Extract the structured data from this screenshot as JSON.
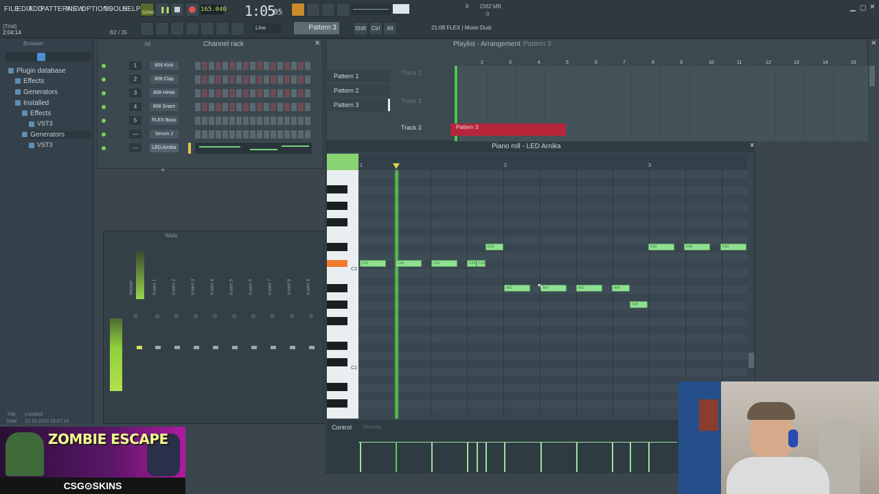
{
  "menu": [
    "FILE",
    "EDIT",
    "ADD",
    "PATTERNS",
    "VIEW",
    "OPTIONS",
    "TOOLS",
    "HELP"
  ],
  "transport": {
    "song_label": "SONG",
    "tempo": "165.040",
    "time": "1:05",
    "time_sub": "05",
    "cpu": "8",
    "memory": "1582 MB",
    "voices": "0"
  },
  "status": {
    "trial": "(Trial)",
    "position": "2:04:14",
    "bar": "B2 / 35"
  },
  "toolbar": {
    "snap_mode": "Line",
    "pattern": "Pattern 3",
    "shift": "Shift",
    "ctrl": "Ctrl",
    "alt": "Alt",
    "hint": "21:08 FLEX | Moon Dust"
  },
  "browser": {
    "title": "Browser",
    "filter": "All",
    "items": [
      {
        "label": "Plugin database",
        "indent": 0
      },
      {
        "label": "Effects",
        "indent": 1
      },
      {
        "label": "Generators",
        "indent": 1
      },
      {
        "label": "Installed",
        "indent": 1
      },
      {
        "label": "Effects",
        "indent": 2
      },
      {
        "label": "VST3",
        "indent": 3
      },
      {
        "label": "Generators",
        "indent": 2
      },
      {
        "label": "VST3",
        "indent": 3
      }
    ],
    "footer_title_label": "Title",
    "footer_title_value": "Installed",
    "footer_date_label": "Date",
    "footer_date_value": "23.10.2023 16:07:18"
  },
  "channel_rack": {
    "title": "Channel rack",
    "filter": "All",
    "channels": [
      {
        "num": "1",
        "name": "808 Kick"
      },
      {
        "num": "2",
        "name": "808 Clap"
      },
      {
        "num": "3",
        "name": "808 HiHat"
      },
      {
        "num": "4",
        "name": "808 Snare"
      },
      {
        "num": "5",
        "name": "FLEX Bass"
      },
      {
        "num": "—",
        "name": "Serum 2"
      },
      {
        "num": "—",
        "name": "LED Arnika"
      }
    ]
  },
  "mixer": {
    "title": "Wide",
    "strips": [
      "Master",
      "Insert 1",
      "Insert 2",
      "Insert 3",
      "Insert 4",
      "Insert 5",
      "Insert 6",
      "Insert 7",
      "Insert 8",
      "Insert 9"
    ]
  },
  "playlist": {
    "title": "Playlist - Arrangement",
    "pattern": "Pattern 3",
    "patterns": [
      "Pattern 1",
      "Pattern 2",
      "Pattern 3"
    ],
    "tracks": [
      "Track 1",
      "Track 2",
      "Track 3"
    ],
    "ruler": [
      "2",
      "3",
      "4",
      "5",
      "6",
      "7",
      "8",
      "9",
      "10",
      "11",
      "12",
      "13",
      "14",
      "15"
    ],
    "clip_label": "Pattern 3"
  },
  "piano_roll": {
    "title": "Piano roll - LED Arnika",
    "ruler": [
      "1",
      "2",
      "3"
    ],
    "octave_labels": [
      "C3",
      "C2"
    ],
    "control_label": "Control",
    "control_param": "Velocity",
    "notes": [
      {
        "label": "C#3",
        "row": 2
      },
      {
        "label": "C#3",
        "row": 2
      },
      {
        "label": "C#3",
        "row": 2
      },
      {
        "label": "C#3",
        "row": 2
      },
      {
        "label": "C#3",
        "row": 2
      },
      {
        "label": "D#3",
        "row": 0
      },
      {
        "label": "A#2",
        "row": 5
      },
      {
        "label": "A#2",
        "row": 5
      },
      {
        "label": "A#2",
        "row": 5
      },
      {
        "label": "A#2",
        "row": 5
      },
      {
        "label": "G#2",
        "row": 7
      },
      {
        "label": "D#3",
        "row": 0
      },
      {
        "label": "D#3",
        "row": 0
      },
      {
        "label": "D#3",
        "row": 0
      }
    ]
  },
  "overlay": {
    "banner_title": "ZOMBIE ESCAPE",
    "banner_brand": "CSG⊙SKINS"
  }
}
